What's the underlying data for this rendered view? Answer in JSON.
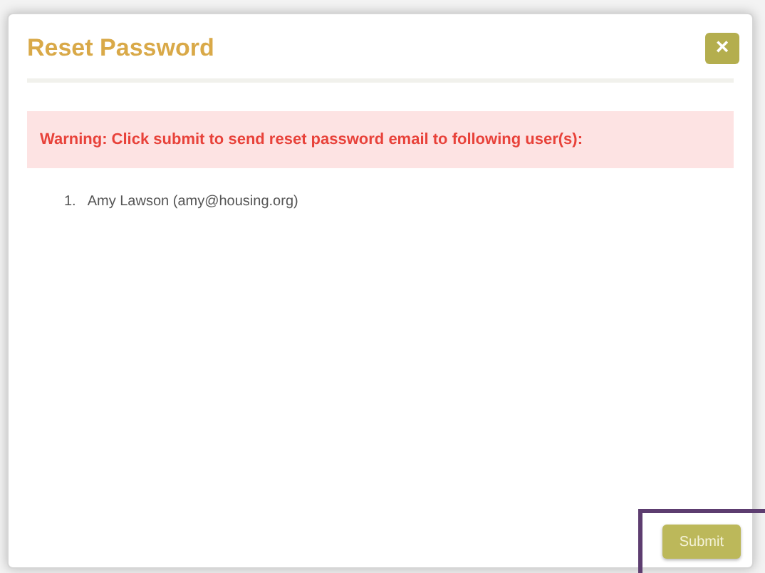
{
  "dialog": {
    "title": "Reset Password",
    "close_label": "×"
  },
  "warning": "Warning: Click submit to send reset password email to following user(s):",
  "users": [
    {
      "number": "1.",
      "text": "Amy Lawson (amy@housing.org)"
    }
  ],
  "buttons": [
    {
      "label": "Submit",
      "highlighted": true
    }
  ]
}
